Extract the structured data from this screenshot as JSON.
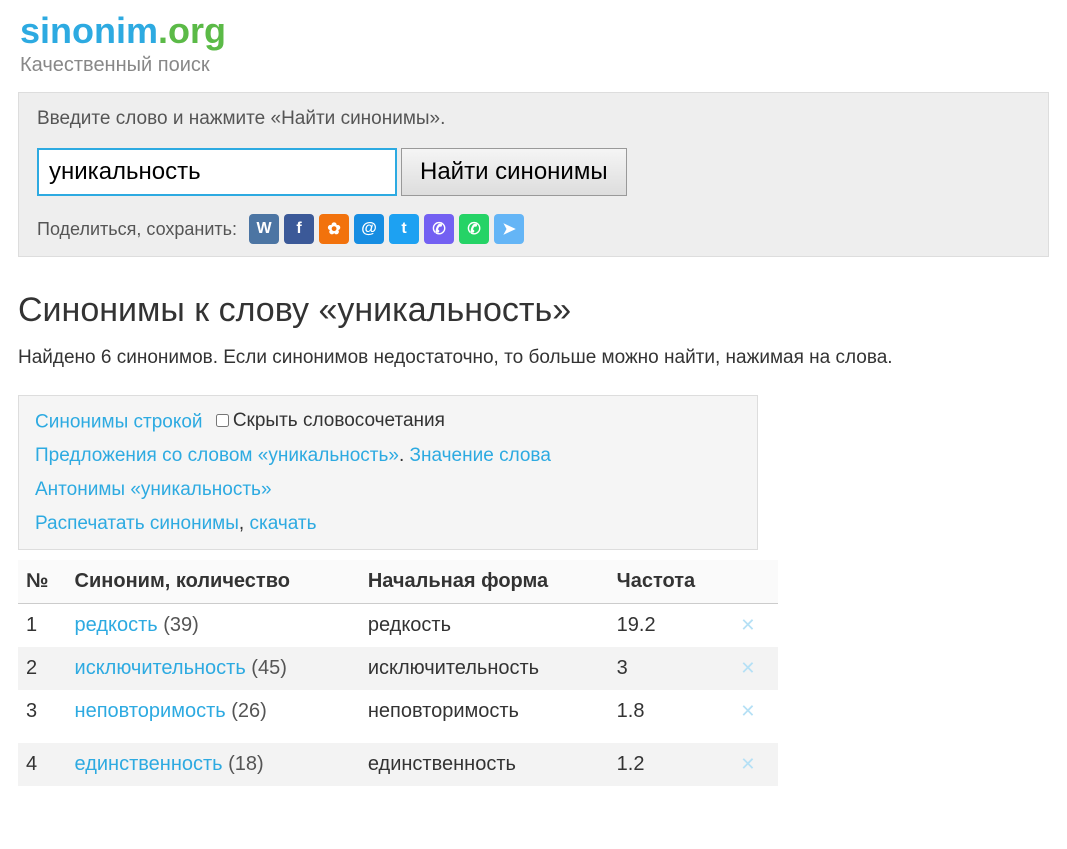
{
  "logo": {
    "sinonim": "sinonim",
    "dot": ".",
    "org": "org"
  },
  "tagline": "Качественный поиск",
  "search": {
    "hint": "Введите слово и нажмите «Найти синонимы».",
    "value": "уникальность",
    "button": "Найти синонимы",
    "share_label": "Поделиться, сохранить:"
  },
  "share_icons": [
    {
      "name": "vk",
      "color": "#4C75A3",
      "glyph": "W"
    },
    {
      "name": "facebook",
      "color": "#3B5998",
      "glyph": "f"
    },
    {
      "name": "odnoklassniki",
      "color": "#F2720C",
      "glyph": "✿"
    },
    {
      "name": "mailru",
      "color": "#168DE2",
      "glyph": "@"
    },
    {
      "name": "twitter",
      "color": "#1DA1F2",
      "glyph": "t"
    },
    {
      "name": "viber",
      "color": "#7360F2",
      "glyph": "✆"
    },
    {
      "name": "whatsapp",
      "color": "#25D366",
      "glyph": "✆"
    },
    {
      "name": "telegram",
      "color": "#64B5F6",
      "glyph": "➤"
    }
  ],
  "title": "Синонимы к слову «уникальность»",
  "found_text": "Найдено 6 синонимов. Если синонимов недостаточно, то больше можно найти, нажимая на слова.",
  "links": {
    "synonyms_line": "Синонимы строкой",
    "hide_phrases": "Скрыть словосочетания",
    "sentences": "Предложения со словом «уникальность»",
    "meaning": "Значение слова",
    "antonyms": "Антонимы «уникальность»",
    "print": "Распечатать синонимы",
    "download": "скачать"
  },
  "table": {
    "headers": {
      "num": "№",
      "synonym": "Синоним, количество",
      "base": "Начальная форма",
      "freq": "Частота"
    },
    "rows": [
      {
        "num": "1",
        "word": "редкость",
        "count": "(39)",
        "base": "редкость",
        "freq": "19.2"
      },
      {
        "num": "2",
        "word": "исключительность",
        "count": "(45)",
        "base": "исключительность",
        "freq": "3"
      },
      {
        "num": "3",
        "word": "неповторимость",
        "count": "(26)",
        "base": "неповторимость",
        "freq": "1.8"
      },
      {
        "num": "4",
        "word": "единственность",
        "count": "(18)",
        "base": "единственность",
        "freq": "1.2"
      }
    ]
  }
}
